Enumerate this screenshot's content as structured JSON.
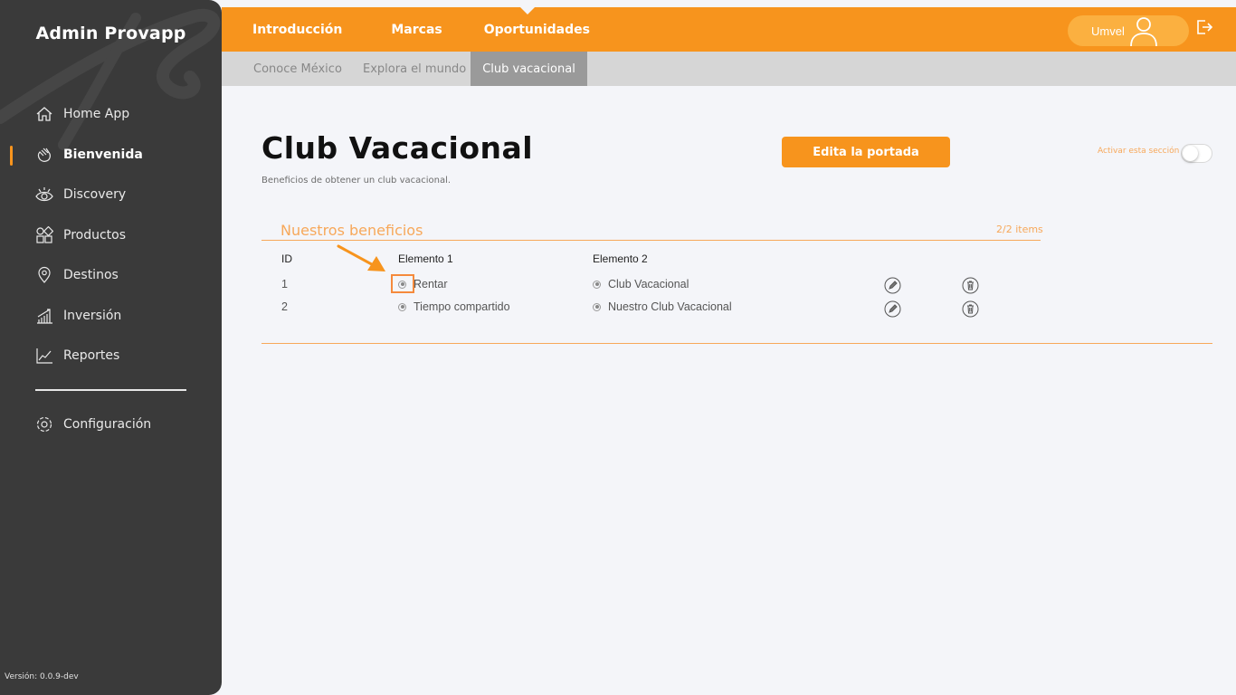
{
  "app": {
    "brand": "Admin Provapp",
    "version": "Versión: 0.0.9-dev"
  },
  "sidebar": {
    "items": [
      {
        "label": "Home App",
        "icon": "home-icon"
      },
      {
        "label": "Bienvenida",
        "icon": "waving-hand-icon",
        "active": true
      },
      {
        "label": "Discovery",
        "icon": "eye-icon"
      },
      {
        "label": "Productos",
        "icon": "grid-shapes-icon"
      },
      {
        "label": "Destinos",
        "icon": "location-pin-icon"
      },
      {
        "label": "Inversión",
        "icon": "bar-growth-icon"
      },
      {
        "label": "Reportes",
        "icon": "line-chart-icon"
      }
    ],
    "config": {
      "label": "Configuración",
      "icon": "gear-icon"
    }
  },
  "header": {
    "tabs": [
      "Introducción",
      "Marcas",
      "Oportunidades"
    ],
    "active_tab": "Oportunidades",
    "user": "Umvel"
  },
  "subnav": {
    "tabs": [
      "Conoce México",
      "Explora el mundo",
      "Club vacacional"
    ],
    "active_tab": "Club vacacional"
  },
  "main": {
    "title": "Club Vacacional",
    "subtitle": "Beneficios de obtener un club vacacional.",
    "edit_button": "Edita la portada",
    "toggle_label": "Activar esta sección",
    "toggle_on": false,
    "section": {
      "title": "Nuestros beneficios",
      "count": "2/2 items",
      "columns": [
        "ID",
        "Elemento 1",
        "Elemento 2"
      ],
      "rows": [
        {
          "id": "1",
          "e1": "Rentar",
          "e2": "Club Vacacional"
        },
        {
          "id": "2",
          "e1": "Tiempo compartido",
          "e2": "Nuestro Club Vacacional"
        }
      ]
    }
  },
  "colors": {
    "accent": "#f7941d",
    "sidebar": "#3a3a3a",
    "subbar": "#d6d6d6",
    "background": "#f4f5f9"
  }
}
